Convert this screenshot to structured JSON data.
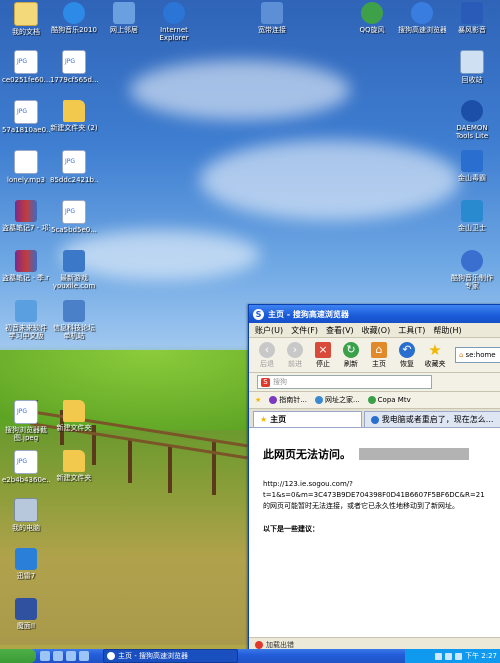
{
  "desktop": {
    "icons": [
      {
        "label": "我的文档",
        "icon": "my-documents-icon"
      },
      {
        "label": "酷狗音乐2010",
        "icon": "kugou-music-icon"
      },
      {
        "label": "网上邻居",
        "icon": "network-icon"
      },
      {
        "label": "Internet Explorer",
        "icon": "ie-icon"
      },
      {
        "label": "宽带连接",
        "icon": "broadband-icon"
      },
      {
        "label": "QQ旋风",
        "icon": "qq-whirlwind-icon"
      },
      {
        "label": "搜狗高速浏览器",
        "icon": "sogou-browser-icon"
      },
      {
        "label": "暴风影音",
        "icon": "baofeng-icon"
      },
      {
        "label": "ce0251fe60...",
        "icon": "jpg-file-icon"
      },
      {
        "label": "1779cf565d...",
        "icon": "jpg-file-icon"
      },
      {
        "label": "回收站",
        "icon": "recycle-bin-icon"
      },
      {
        "label": "57a1810ae0...",
        "icon": "jpg-file-icon"
      },
      {
        "label": "新建文件夹 (2)",
        "icon": "folder-icon"
      },
      {
        "label": "DAEMON Tools Lite",
        "icon": "daemon-tools-icon"
      },
      {
        "label": "lonely.mp3",
        "icon": "mp3-file-icon"
      },
      {
        "label": "85ddc2421b...",
        "icon": "jpg-file-icon"
      },
      {
        "label": "金山毒霸",
        "icon": "kingsoft-antivirus-icon"
      },
      {
        "label": "盗墓笔记7 - 邛笼石影.rar",
        "icon": "rar-file-icon"
      },
      {
        "label": "5ca5bd5e0...",
        "icon": "jpg-file-icon"
      },
      {
        "label": "金山卫士",
        "icon": "kingsoft-guard-icon"
      },
      {
        "label": "盗墓笔记 - 季.rar",
        "icon": "rar-file-icon"
      },
      {
        "label": "最新游戏 youxile.com",
        "icon": "game-icon"
      },
      {
        "label": "酷狗音乐制作专家",
        "icon": "kugou-maker-icon"
      },
      {
        "label": "初音未来软件学习中文版",
        "icon": "app-icon"
      },
      {
        "label": "信息科技论坛单机站",
        "icon": "app-icon"
      },
      {
        "label": "搜狗浏览器截图.jpeg",
        "icon": "jpeg-file-icon"
      },
      {
        "label": "新建文件夹",
        "icon": "folder-icon"
      },
      {
        "label": "e2b4b4360e...",
        "icon": "jpg-file-icon"
      },
      {
        "label": "新建文件夹",
        "icon": "folder-icon"
      },
      {
        "label": "我的电脑",
        "icon": "my-computer-icon"
      },
      {
        "label": "迅雷7",
        "icon": "thunder-icon"
      },
      {
        "label": "魔面II",
        "icon": "app-icon"
      }
    ]
  },
  "browser": {
    "title": "主页 - 搜狗高速浏览器",
    "menu": [
      "账户(U)",
      "文件(F)",
      "查看(V)",
      "收藏(O)",
      "工具(T)",
      "帮助(H)"
    ],
    "toolbar": {
      "back": "后退",
      "forward": "前进",
      "stop": "停止",
      "refresh": "刷新",
      "home": "主页",
      "restore": "恢复",
      "favorites": "收藏夹"
    },
    "address": "se:home",
    "search_placeholder": "搜狗",
    "favorites": [
      "指南针...",
      "网址之家...",
      "Copa Mtv"
    ],
    "tabs": [
      "主页",
      "我电脑或者重启了，现在怎么..."
    ],
    "page": {
      "heading": "此网页无法访问。",
      "url_line1": "http://123.ie.sogou.com/?",
      "url_line2": "t=1&s=0&m=3C473B9DE704398F0D41B6607F5BF6DC&R=21",
      "error_text": "的网页可能暂时无法连接，或者它已永久性地移动到了新网址。",
      "suggestions": "以下是一些建议："
    },
    "status": "加载出错"
  },
  "taskbar": {
    "task_label": "主页 - 搜狗高速浏览器",
    "clock": "下午 2:27"
  }
}
